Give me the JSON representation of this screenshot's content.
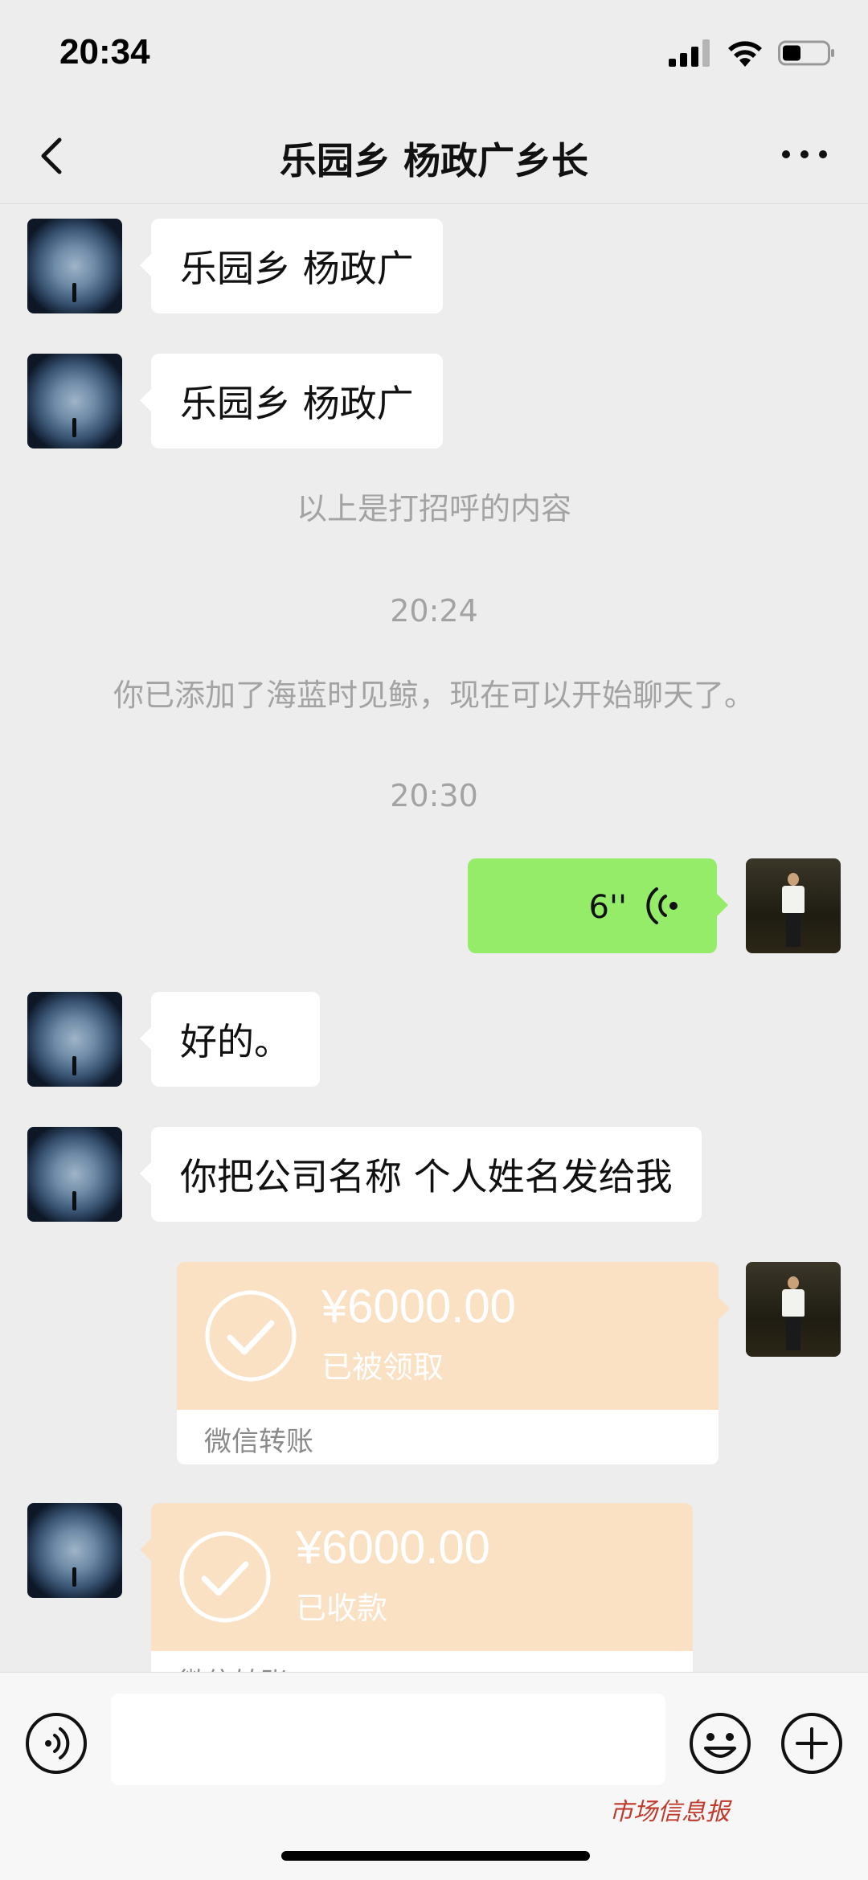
{
  "status_bar": {
    "time": "20:34"
  },
  "nav": {
    "title": "乐园乡 杨政广乡长"
  },
  "messages": {
    "m1": "乐园乡 杨政广",
    "m2": "乐园乡 杨政广",
    "sys_greeting": "以上是打招呼的内容",
    "time1": "20:24",
    "sys_added": "你已添加了海蓝时见鲸，现在可以开始聊天了。",
    "time2": "20:30",
    "voice_duration": "6''",
    "m3": "好的。",
    "m4": "你把公司名称 个人姓名发给我"
  },
  "transfers": [
    {
      "amount": "¥6000.00",
      "status": "已被领取",
      "label": "微信转账"
    },
    {
      "amount": "¥6000.00",
      "status": "已收款",
      "label": "微信转账"
    }
  ],
  "footer": {
    "watermark": "市场信息报"
  },
  "colors": {
    "background": "#ededed",
    "self_bubble": "#95ec69",
    "transfer": "#fbe1c4"
  },
  "icons": [
    "back-icon",
    "more-icon",
    "voice-wave-icon",
    "check-icon",
    "voice-input-icon",
    "emoji-icon",
    "plus-icon",
    "signal-icon",
    "wifi-icon",
    "battery-icon"
  ]
}
